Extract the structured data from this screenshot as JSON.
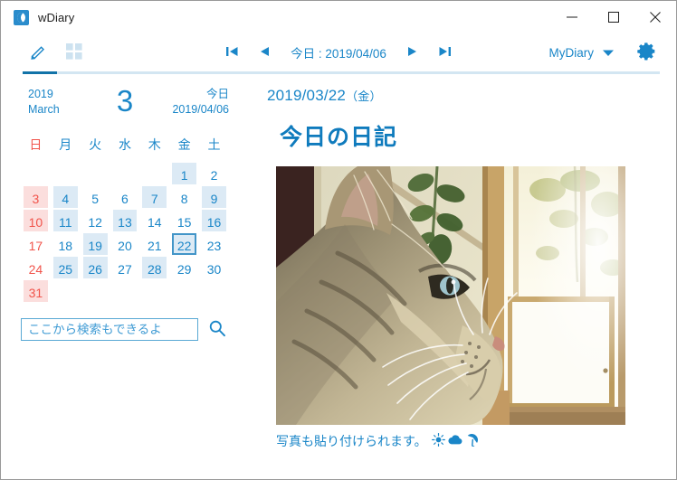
{
  "window": {
    "title": "wDiary",
    "app_icon": "moon-icon",
    "controls": {
      "minimize": "minimize-icon",
      "maximize": "maximize-icon",
      "close": "close-icon"
    }
  },
  "toolbar": {
    "tabs": [
      {
        "name": "edit",
        "icon": "pencil-icon",
        "active": true
      },
      {
        "name": "tiles",
        "icon": "grid-icon",
        "active": false
      }
    ],
    "nav": {
      "first": "skip-back-icon",
      "prev": "triangle-left-icon",
      "next": "triangle-right-icon",
      "last": "skip-forward-icon"
    },
    "today_label": "今日 : 2019/04/06",
    "diary_name": "MyDiary",
    "dropdown_icon": "chevron-down-icon",
    "settings_icon": "gear-icon",
    "accent": "#1a86c8",
    "rule_color": "#d3e6f2",
    "rule_active_color": "#1273a8"
  },
  "sidebar": {
    "calendar": {
      "year": "2019",
      "month_name": "March",
      "month_number": "3",
      "today_caption": "今日",
      "today_date": "2019/04/06",
      "weekdays": [
        "日",
        "月",
        "火",
        "水",
        "木",
        "金",
        "土"
      ],
      "weeks": [
        [
          {
            "day": "",
            "state": "empty"
          },
          {
            "day": "",
            "state": "empty"
          },
          {
            "day": "",
            "state": "empty"
          },
          {
            "day": "",
            "state": "empty"
          },
          {
            "day": "",
            "state": "empty"
          },
          {
            "day": "1",
            "state": "entry"
          },
          {
            "day": "2",
            "state": "none"
          }
        ],
        [
          {
            "day": "3",
            "state": "holiday"
          },
          {
            "day": "4",
            "state": "entry"
          },
          {
            "day": "5",
            "state": "none"
          },
          {
            "day": "6",
            "state": "none"
          },
          {
            "day": "7",
            "state": "entry"
          },
          {
            "day": "8",
            "state": "none"
          },
          {
            "day": "9",
            "state": "entry"
          }
        ],
        [
          {
            "day": "10",
            "state": "holiday"
          },
          {
            "day": "11",
            "state": "entry"
          },
          {
            "day": "12",
            "state": "none"
          },
          {
            "day": "13",
            "state": "entry"
          },
          {
            "day": "14",
            "state": "none"
          },
          {
            "day": "15",
            "state": "none"
          },
          {
            "day": "16",
            "state": "entry"
          }
        ],
        [
          {
            "day": "17",
            "state": "none"
          },
          {
            "day": "18",
            "state": "none"
          },
          {
            "day": "19",
            "state": "entry"
          },
          {
            "day": "20",
            "state": "none"
          },
          {
            "day": "21",
            "state": "none"
          },
          {
            "day": "22",
            "state": "selected"
          },
          {
            "day": "23",
            "state": "none"
          }
        ],
        [
          {
            "day": "24",
            "state": "none"
          },
          {
            "day": "25",
            "state": "entry"
          },
          {
            "day": "26",
            "state": "entry"
          },
          {
            "day": "27",
            "state": "none"
          },
          {
            "day": "28",
            "state": "entry"
          },
          {
            "day": "29",
            "state": "none"
          },
          {
            "day": "30",
            "state": "none"
          }
        ],
        [
          {
            "day": "31",
            "state": "holiday"
          },
          {
            "day": "",
            "state": "empty"
          },
          {
            "day": "",
            "state": "empty"
          },
          {
            "day": "",
            "state": "empty"
          },
          {
            "day": "",
            "state": "empty"
          },
          {
            "day": "",
            "state": "empty"
          },
          {
            "day": "",
            "state": "empty"
          }
        ]
      ],
      "sunday_color": "#f1544b",
      "entry_color": "#dceaf5",
      "holiday_color": "#fbdedd",
      "selected_border_color": "#4295c8"
    },
    "search": {
      "value": "",
      "placeholder": "ここから検索もできるよ",
      "button_icon": "search-icon"
    }
  },
  "main": {
    "entry_date": "2019/03/22",
    "entry_weekday": "（金）",
    "entry_title": "今日の日記",
    "photo_alt": "tabby-cat-looking-out-window",
    "caption_text": "写真も貼り付けられます。",
    "caption_icons": [
      "sun-icon",
      "cloud-icon",
      "umbrella-icon"
    ]
  }
}
